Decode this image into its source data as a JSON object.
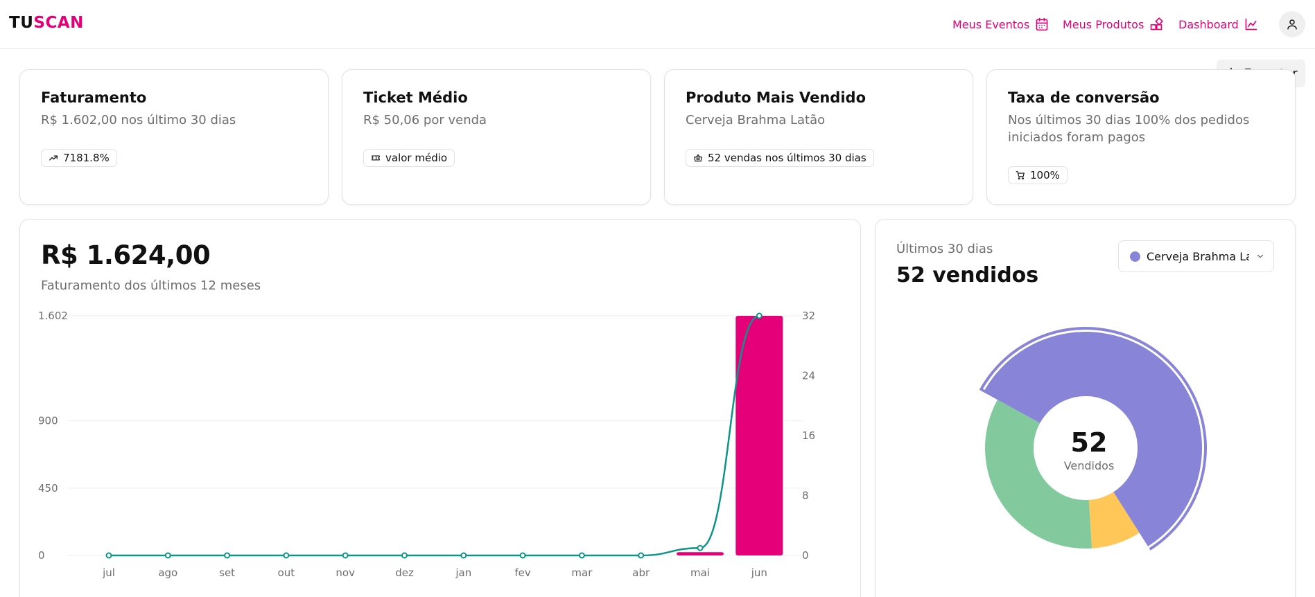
{
  "brand": {
    "part1": "TU",
    "part2": "SCAN"
  },
  "nav": {
    "events": "Meus Eventos",
    "products": "Meus Produtos",
    "dashboard": "Dashboard"
  },
  "export_label": "Exportar",
  "kpis": [
    {
      "title": "Faturamento",
      "subtitle": "R$ 1.602,00 nos último 30 dias",
      "badge": "7181.8%",
      "icon": "trending-up-icon"
    },
    {
      "title": "Ticket Médio",
      "subtitle": "R$ 50,06 por venda",
      "badge": "valor médio",
      "icon": "ticket-icon"
    },
    {
      "title": "Produto Mais Vendido",
      "subtitle": "Cerveja Brahma Latão",
      "badge": "52 vendas nos últimos 30 dias",
      "icon": "basket-icon"
    },
    {
      "title": "Taxa de conversão",
      "subtitle": "Nos últimos 30 dias 100% dos pedidos iniciados foram pagos",
      "badge": "100%",
      "icon": "cart-icon"
    }
  ],
  "revenue": {
    "amount": "R$ 1.624,00",
    "subtitle": "Faturamento dos últimos 12 meses"
  },
  "chart_data": {
    "type": "bar",
    "categories": [
      "jul",
      "ago",
      "set",
      "out",
      "nov",
      "dez",
      "jan",
      "fev",
      "mar",
      "abr",
      "mai",
      "jun"
    ],
    "series": [
      {
        "values": [
          0,
          0,
          0,
          0,
          0,
          0,
          0,
          0,
          0,
          0,
          22,
          1602
        ],
        "axis": "left",
        "type": "bar",
        "color": "#e5007a"
      },
      {
        "values": [
          0,
          0,
          0,
          0,
          0,
          0,
          0,
          0,
          0,
          0,
          1,
          32
        ],
        "axis": "right",
        "type": "line",
        "color": "#0d9488"
      }
    ],
    "y_left_ticks": [
      "0",
      "450",
      "900",
      "1.602"
    ],
    "y_left_range": [
      0,
      1602
    ],
    "y_right_ticks": [
      "0",
      "8",
      "16",
      "24",
      "32"
    ],
    "y_right_range": [
      0,
      32
    ],
    "grid": true
  },
  "product_sales": {
    "period": "Últimos 30 dias",
    "headline": "52 vendidos",
    "selected_product": "Cerveja Brahma Latão",
    "selected_color": "#8884d8",
    "center_value": "52",
    "center_label": "Vendidos",
    "pie": {
      "type": "pie",
      "slices": [
        {
          "share": 0.58,
          "color": "#8884d8",
          "highlighted": true
        },
        {
          "share": 0.08,
          "color": "#ffc658"
        },
        {
          "share": 0.34,
          "color": "#82ca9d"
        }
      ]
    }
  }
}
